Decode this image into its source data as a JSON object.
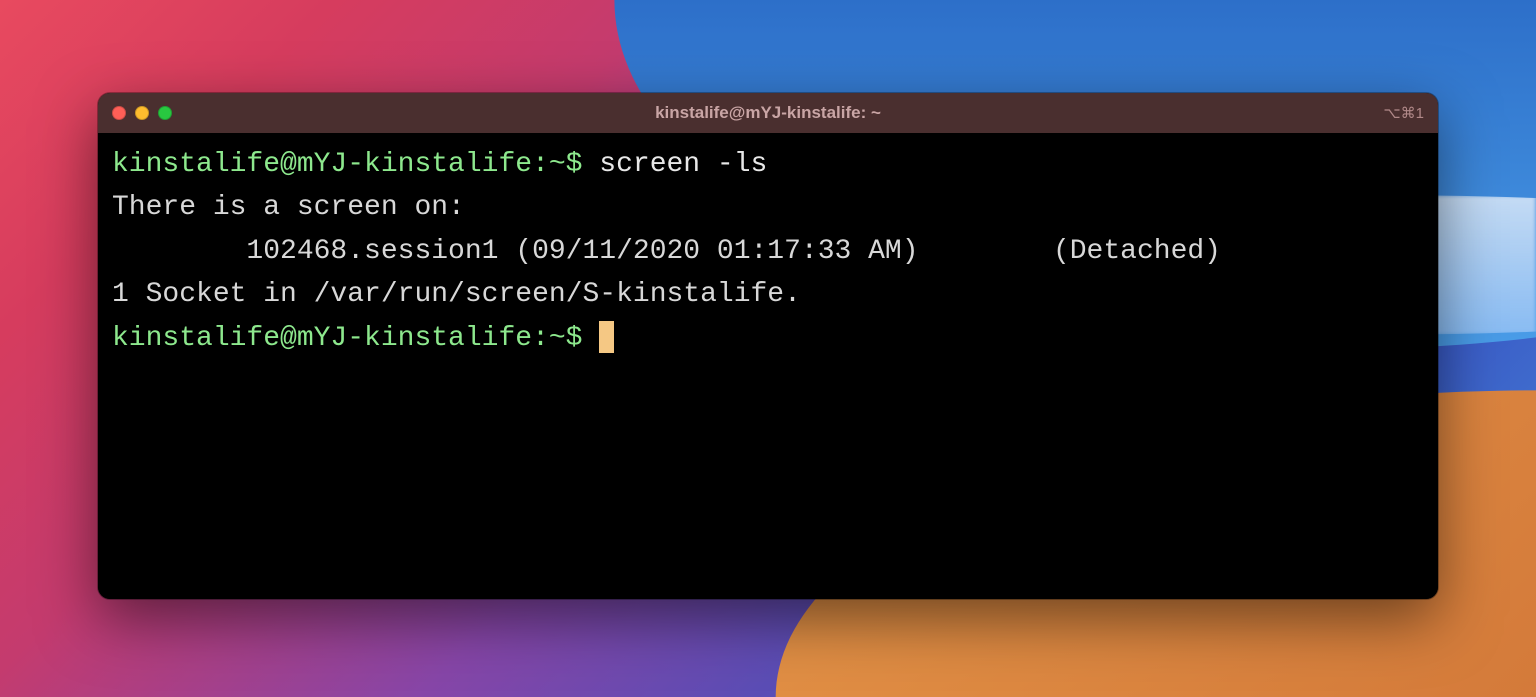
{
  "window": {
    "title": "kinstalife@mYJ-kinstalife: ~",
    "tab_indicator": "⌥⌘1"
  },
  "terminal": {
    "line1": {
      "prompt": "kinstalife@mYJ-kinstalife:~$ ",
      "command": "screen -ls"
    },
    "line2": "There is a screen on:",
    "line3": "        102468.session1 (09/11/2020 01:17:33 AM)        (Detached)",
    "line4": "1 Socket in /var/run/screen/S-kinstalife.",
    "line5": {
      "prompt": "kinstalife@mYJ-kinstalife:~$ "
    }
  }
}
